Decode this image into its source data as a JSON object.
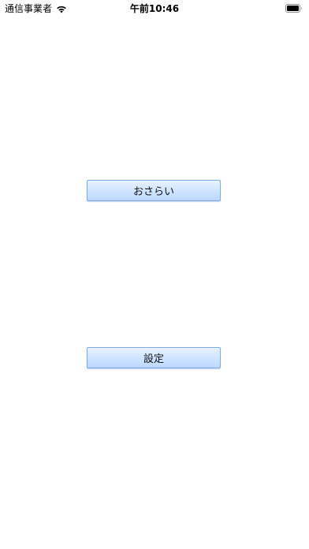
{
  "status_bar": {
    "carrier": "通信事業者",
    "time": "午前10:46",
    "wifi_icon": "wifi-icon",
    "battery_icon": "battery-icon"
  },
  "main": {
    "review_button_label": "おさらい",
    "settings_button_label": "設定"
  },
  "colors": {
    "button_border": "#7fa9e6",
    "button_fill_top": "#e8f2ff",
    "button_fill_bottom": "#bcd8ff"
  }
}
